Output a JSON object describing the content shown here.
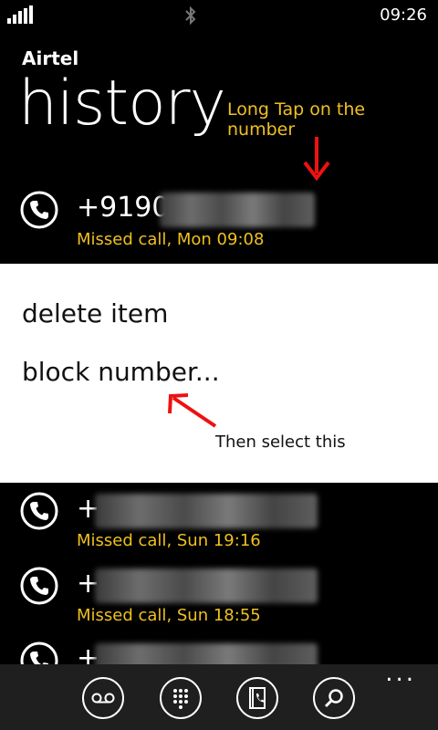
{
  "status_bar": {
    "time": "09:26"
  },
  "carrier": "Airtel",
  "page_title": "history",
  "annotations": {
    "top": "Long Tap on the number",
    "bottom": "Then select this"
  },
  "selected_call": {
    "number": "+9190",
    "status": "Missed call, Mon 09:08"
  },
  "context_menu": {
    "delete": "delete item",
    "block": "block number..."
  },
  "calls": [
    {
      "number": "+",
      "status": "Missed call, Sun 19:16"
    },
    {
      "number": "+",
      "status": "Missed call, Sun 18:55"
    },
    {
      "number": "+",
      "status": ""
    }
  ],
  "app_bar": {
    "more": "..."
  },
  "colors": {
    "accent": "#f0c020",
    "annotation_arrow": "#ee1111",
    "background": "#000000",
    "menu_bg": "#ffffff"
  }
}
